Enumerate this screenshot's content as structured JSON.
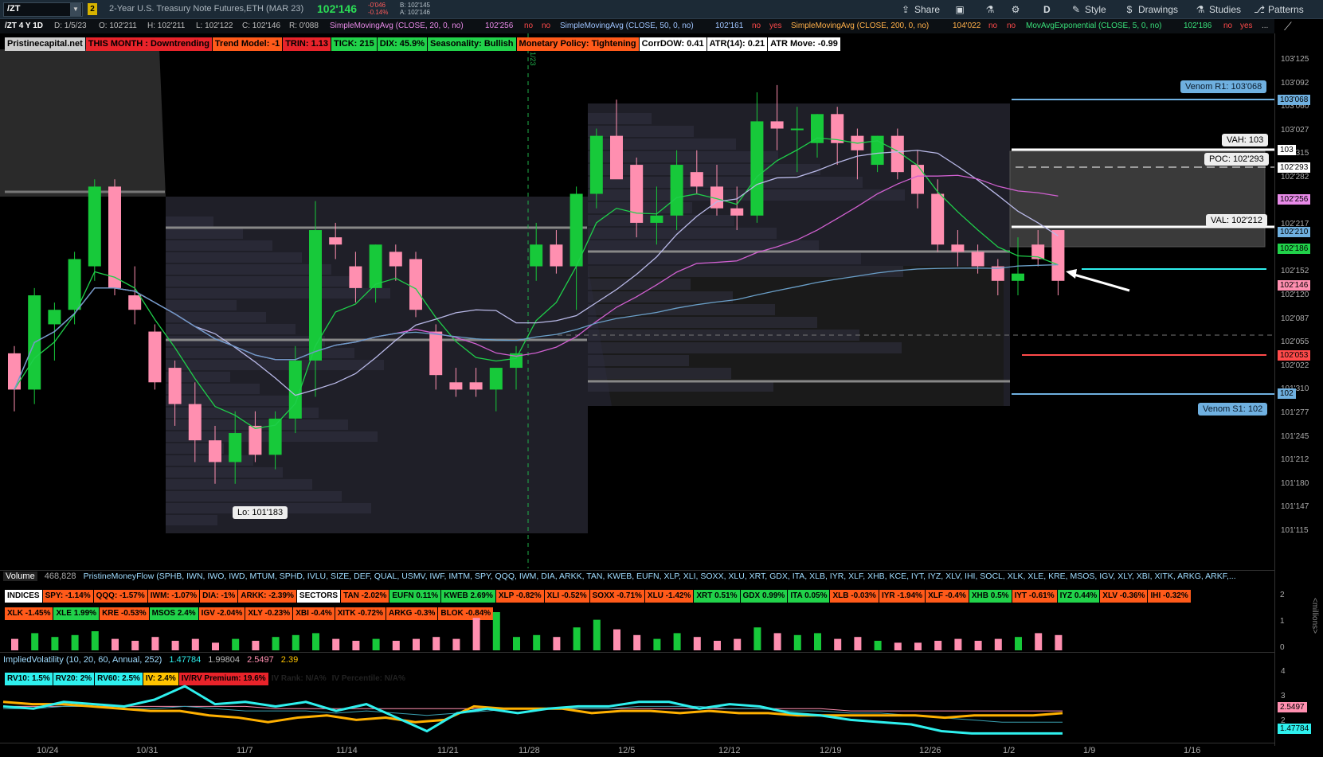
{
  "toolbar": {
    "symbol": "/ZT",
    "link_badge": "2",
    "title": "2-Year U.S. Treasury Note Futures,ETH (MAR 23)",
    "last_price": "102'146",
    "net_change": "-0'046",
    "pct_change": "-0.14%",
    "bid": "B: 102'145",
    "ask": "A: 102'146",
    "share_label": "Share",
    "period_label": "D",
    "style_label": "Style",
    "drawings_label": "Drawings",
    "studies_label": "Studies",
    "patterns_label": "Patterns"
  },
  "info_row": {
    "study_title": "/ZT 4 Y 1D",
    "date": "D: 1/5/23",
    "open": "O: 102'211",
    "high": "H: 102'211",
    "low": "L: 102'122",
    "close": "C: 102'146",
    "range": "R: 0'088",
    "sma20": "SimpleMovingAvg (CLOSE, 20, 0, no)",
    "sma20_val": "102'256",
    "sma20_f1": "no",
    "sma20_f2": "no",
    "sma50": "SimpleMovingAvg (CLOSE, 50, 0, no)",
    "sma50_val": "102'161",
    "sma50_f1": "no",
    "sma50_f2": "yes",
    "sma200": "SimpleMovingAvg (CLOSE, 200, 0, no)",
    "sma200_val": "104'022",
    "sma200_f1": "no",
    "sma200_f2": "no",
    "ema5": "MovAvgExponential (CLOSE, 5, 0, no)",
    "ema5_val": "102'186",
    "ema5_f1": "no",
    "ema5_f2": "yes",
    "more": "..."
  },
  "badges": [
    {
      "text": "Pristinecapital.net",
      "cls": "b-gray"
    },
    {
      "text": "THIS MONTH : Downtrending",
      "cls": "b-red"
    },
    {
      "text": "Trend Model: -1",
      "cls": "b-orange"
    },
    {
      "text": "TRIN: 1.13",
      "cls": "b-red"
    },
    {
      "text": "TICK: 215",
      "cls": "b-green"
    },
    {
      "text": "DIX: 45.9%",
      "cls": "b-green"
    },
    {
      "text": "Seasonality: Bullish",
      "cls": "b-green"
    },
    {
      "text": "Monetary Policy: Tightening",
      "cls": "b-orange"
    },
    {
      "text": "CorrDOW: 0.41",
      "cls": "b-white"
    },
    {
      "text": "ATR(14): 0.21",
      "cls": "b-white"
    },
    {
      "text": "ATR Move: -0.99",
      "cls": "b-white"
    }
  ],
  "price_axis": [
    "103'125",
    "103'092",
    "103'060",
    "103'027",
    "102'315",
    "102'282",
    "102'250",
    "102'217",
    "102'185",
    "102'152",
    "102'120",
    "102'087",
    "102'055",
    "102'022",
    "101'310",
    "101'277",
    "101'245",
    "101'212",
    "101'180",
    "101'147",
    "101'115"
  ],
  "price_tags": [
    {
      "text": "103'068",
      "color": "#6fb0e0"
    },
    {
      "text": "103",
      "color": "#ffffff"
    },
    {
      "text": "102'293",
      "color": "#ffffff"
    },
    {
      "text": "102'256",
      "color": "#e88ae8"
    },
    {
      "text": "102'210",
      "color": "#6fb0e0"
    },
    {
      "text": "102'186",
      "color": "#21d24a"
    },
    {
      "text": "102'146",
      "color": "#ff8fb0"
    },
    {
      "text": "102'053",
      "color": "#ff4a4a"
    },
    {
      "text": "102",
      "color": "#6fb0e0"
    }
  ],
  "levels": {
    "venom_r1": "Venom R1: 103'068",
    "vah": "VAH: 103",
    "poc": "POC: 102'293",
    "val": "VAL: 102'212",
    "venom_s1": "Venom S1: 102",
    "low_label": "Lo: 101'183",
    "vline_date": "1/23"
  },
  "chart_data": {
    "type": "candlestick",
    "x": [
      "10/20",
      "10/21",
      "10/24",
      "10/25",
      "10/26",
      "10/27",
      "10/28",
      "10/31",
      "11/1",
      "11/2",
      "11/3",
      "11/4",
      "11/7",
      "11/8",
      "11/9",
      "11/10",
      "11/11",
      "11/14",
      "11/15",
      "11/16",
      "11/17",
      "11/18",
      "11/21",
      "11/22",
      "11/23",
      "11/25",
      "11/28",
      "11/29",
      "11/30",
      "12/1",
      "12/2",
      "12/5",
      "12/6",
      "12/7",
      "12/8",
      "12/9",
      "12/12",
      "12/13",
      "12/14",
      "12/15",
      "12/16",
      "12/19",
      "12/20",
      "12/21",
      "12/22",
      "12/23",
      "12/27",
      "12/28",
      "12/29",
      "12/30",
      "1/3",
      "1/4",
      "1/5"
    ],
    "ohlc": [
      [
        102.04,
        102.05,
        101.28,
        101.31
      ],
      [
        101.31,
        102.13,
        101.29,
        102.12
      ],
      [
        102.08,
        102.11,
        102.03,
        102.1
      ],
      [
        102.1,
        102.18,
        102.08,
        102.17
      ],
      [
        102.16,
        102.28,
        102.14,
        102.27
      ],
      [
        102.27,
        102.28,
        102.12,
        102.13
      ],
      [
        102.12,
        102.16,
        102.08,
        102.1
      ],
      [
        102.07,
        102.08,
        101.31,
        102.0
      ],
      [
        102.02,
        102.03,
        101.26,
        101.29
      ],
      [
        101.29,
        102.0,
        101.21,
        101.24
      ],
      [
        101.24,
        101.26,
        101.18,
        101.21
      ],
      [
        101.21,
        101.28,
        101.18,
        101.25
      ],
      [
        101.26,
        101.28,
        101.21,
        101.22
      ],
      [
        101.22,
        101.28,
        101.2,
        101.27
      ],
      [
        101.27,
        102.05,
        101.25,
        102.03
      ],
      [
        102.03,
        102.25,
        101.3,
        102.21
      ],
      [
        102.2,
        102.22,
        102.17,
        102.19
      ],
      [
        102.16,
        102.18,
        102.11,
        102.13
      ],
      [
        102.13,
        102.19,
        102.11,
        102.19
      ],
      [
        102.18,
        102.19,
        102.14,
        102.16
      ],
      [
        102.17,
        102.18,
        102.09,
        102.1
      ],
      [
        102.07,
        102.08,
        101.31,
        102.01
      ],
      [
        102.0,
        102.02,
        101.3,
        101.31
      ],
      [
        102.0,
        102.02,
        101.3,
        101.31
      ],
      [
        101.31,
        102.02,
        101.28,
        102.02
      ],
      [
        102.02,
        102.05,
        101.31,
        102.04
      ],
      [
        102.16,
        102.22,
        102.14,
        102.19
      ],
      [
        102.19,
        102.21,
        102.15,
        102.16
      ],
      [
        102.16,
        102.27,
        102.1,
        102.26
      ],
      [
        102.26,
        103.03,
        102.24,
        103.02
      ],
      [
        103.02,
        103.07,
        102.29,
        102.28
      ],
      [
        102.3,
        102.31,
        102.2,
        102.22
      ],
      [
        102.22,
        102.27,
        102.19,
        102.23
      ],
      [
        102.23,
        103.0,
        102.21,
        102.3
      ],
      [
        102.29,
        103.0,
        102.26,
        102.27
      ],
      [
        102.27,
        102.3,
        102.23,
        102.24
      ],
      [
        102.24,
        102.27,
        102.21,
        102.23
      ],
      [
        102.23,
        103.08,
        102.22,
        103.04
      ],
      [
        103.04,
        103.09,
        103.0,
        103.03
      ],
      [
        103.03,
        103.06,
        102.29,
        103.03
      ],
      [
        103.01,
        103.05,
        102.31,
        103.05
      ],
      [
        103.05,
        103.06,
        102.3,
        103.01
      ],
      [
        103.02,
        103.03,
        102.28,
        103.0
      ],
      [
        102.3,
        103.02,
        102.29,
        103.02
      ],
      [
        103.02,
        103.03,
        102.28,
        102.29
      ],
      [
        102.3,
        103.0,
        102.24,
        102.26
      ],
      [
        102.26,
        102.28,
        102.18,
        102.19
      ],
      [
        102.19,
        102.21,
        102.16,
        102.18
      ],
      [
        102.18,
        102.19,
        102.15,
        102.16
      ],
      [
        102.16,
        102.17,
        102.12,
        102.14
      ],
      [
        102.14,
        102.2,
        102.12,
        102.15
      ],
      [
        102.19,
        102.21,
        102.16,
        102.17
      ],
      [
        102.21,
        102.21,
        102.12,
        102.14
      ]
    ],
    "volume_ylabel": "<millions>",
    "volume_axis": [
      "2",
      "1",
      "0"
    ],
    "iv_axis": [
      "4",
      "3",
      "2"
    ],
    "iv_tags": [
      {
        "text": "2.5497",
        "color": "#ff8fb0"
      },
      {
        "text": "1.47784",
        "color": "#2ef0ee"
      }
    ],
    "xticks": [
      "10/24",
      "10/31",
      "11/7",
      "11/14",
      "11/21",
      "11/28",
      "12/5",
      "12/12",
      "12/19",
      "12/26",
      "1/2",
      "1/9",
      "1/16"
    ]
  },
  "volume": {
    "label": "Volume",
    "value": "468,828",
    "moneyflow": "PristineMoneyFlow (SPHB, IWN, IWO, IWD, MTUM, SPHD, IVLU, SIZE, DEF, QUAL, USMV, IWF, IMTM, SPY, QQQ, IWM, DIA, ARKK, TAN, KWEB, EUFN, XLP, XLI, SOXX, XLU, XRT, GDX, ITA, XLB, IYR, XLF, XHB, KCE, IYT, IYZ, XLV, IHI, SOCL, XLK, XLE, KRE, MSOS, IGV, XLY, XBI, XITK, ARKG, ARKF,..."
  },
  "sectors_row1": [
    {
      "text": "INDICES",
      "cls": "b-white"
    },
    {
      "text": "SPY: -1.14%",
      "cls": "b-orange"
    },
    {
      "text": "QQQ: -1.57%",
      "cls": "b-orange"
    },
    {
      "text": "IWM: -1.07%",
      "cls": "b-orange"
    },
    {
      "text": "DIA: -1%",
      "cls": "b-orange"
    },
    {
      "text": "ARKK: -2.39%",
      "cls": "b-orange"
    },
    {
      "text": "SECTORS",
      "cls": "b-white"
    },
    {
      "text": "TAN -2.02%",
      "cls": "b-orange"
    },
    {
      "text": "EUFN 0.11%",
      "cls": "b-green"
    },
    {
      "text": "KWEB 2.69%",
      "cls": "b-green"
    },
    {
      "text": "XLP -0.82%",
      "cls": "b-orange"
    },
    {
      "text": "XLI -0.52%",
      "cls": "b-orange"
    },
    {
      "text": "SOXX -0.71%",
      "cls": "b-orange"
    },
    {
      "text": "XLU -1.42%",
      "cls": "b-orange"
    },
    {
      "text": "XRT 0.51%",
      "cls": "b-green"
    },
    {
      "text": "GDX 0.99%",
      "cls": "b-green"
    },
    {
      "text": "ITA 0.05%",
      "cls": "b-green"
    },
    {
      "text": "XLB -0.03%",
      "cls": "b-orange"
    },
    {
      "text": "IYR -1.94%",
      "cls": "b-orange"
    },
    {
      "text": "XLF -0.4%",
      "cls": "b-orange"
    },
    {
      "text": "XHB 0.5%",
      "cls": "b-green"
    },
    {
      "text": "IYT -0.61%",
      "cls": "b-orange"
    },
    {
      "text": "IYZ 0.44%",
      "cls": "b-green"
    },
    {
      "text": "XLV -0.36%",
      "cls": "b-orange"
    },
    {
      "text": "IHI -0.32%",
      "cls": "b-orange"
    }
  ],
  "sectors_row2": [
    {
      "text": "XLK -1.45%",
      "cls": "b-orange"
    },
    {
      "text": "XLE 1.99%",
      "cls": "b-green"
    },
    {
      "text": "KRE -0.53%",
      "cls": "b-orange"
    },
    {
      "text": "MSOS 2.4%",
      "cls": "b-green"
    },
    {
      "text": "IGV -2.04%",
      "cls": "b-orange"
    },
    {
      "text": "XLY -0.23%",
      "cls": "b-orange"
    },
    {
      "text": "XBI -0.4%",
      "cls": "b-orange"
    },
    {
      "text": "XITK -0.72%",
      "cls": "b-orange"
    },
    {
      "text": "ARKG -0.3%",
      "cls": "b-orange"
    },
    {
      "text": "BLOK -0.84%",
      "cls": "b-orange"
    }
  ],
  "iv": {
    "title": "ImpliedVolatility (10, 20, 60, Annual, 252)",
    "v1": "1.47784",
    "v2": "1.99804",
    "v3": "2.5497",
    "v4": "2.39",
    "badges": [
      {
        "text": "RV10: 1.5%",
        "cls": "b-cyan"
      },
      {
        "text": "RV20: 2%",
        "cls": "b-cyan"
      },
      {
        "text": "RV60: 2.5%",
        "cls": "b-cyan"
      },
      {
        "text": "IV: 2.4%",
        "cls": "b-yellow"
      },
      {
        "text": "IV/RV Premium: 19.6%",
        "cls": "b-red"
      },
      {
        "text": "IV Rank: N/A%",
        "cls": "b-dark"
      },
      {
        "text": "IV Percentile: N/A%",
        "cls": "b-dark"
      }
    ]
  }
}
